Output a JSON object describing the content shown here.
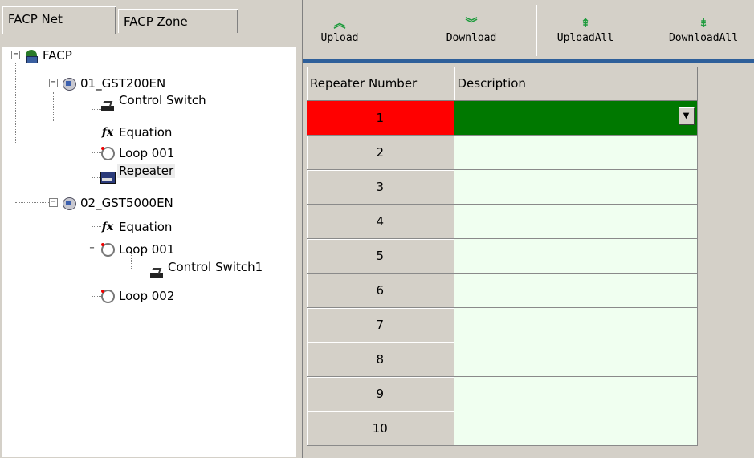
{
  "tabs": {
    "net": "FACP Net",
    "zone": "FACP Zone"
  },
  "tree": {
    "root": "FACP",
    "panels": [
      {
        "label": "01_GST200EN",
        "children": [
          "Control Switch",
          "Equation",
          "Loop 001",
          "Repeater"
        ]
      },
      {
        "label": "02_GST5000EN",
        "children": [
          "Equation",
          "Loop 001",
          "Loop 002"
        ],
        "loop_children": [
          "Control Switch1"
        ]
      }
    ]
  },
  "toolbar": {
    "upload": "Upload",
    "download": "Download",
    "upload_all": "UploadAll",
    "download_all": "DownloadAll"
  },
  "grid": {
    "columns": [
      "Repeater Number",
      "Description"
    ],
    "rows": [
      "1",
      "2",
      "3",
      "4",
      "5",
      "6",
      "7",
      "8",
      "9",
      "10"
    ],
    "selected_row": "1"
  },
  "colors": {
    "selected_number_bg": "#ff0000",
    "selected_description_bg": "#007800",
    "description_bg": "#f0fff0",
    "toolbar_accent": "#2e5f9a"
  }
}
